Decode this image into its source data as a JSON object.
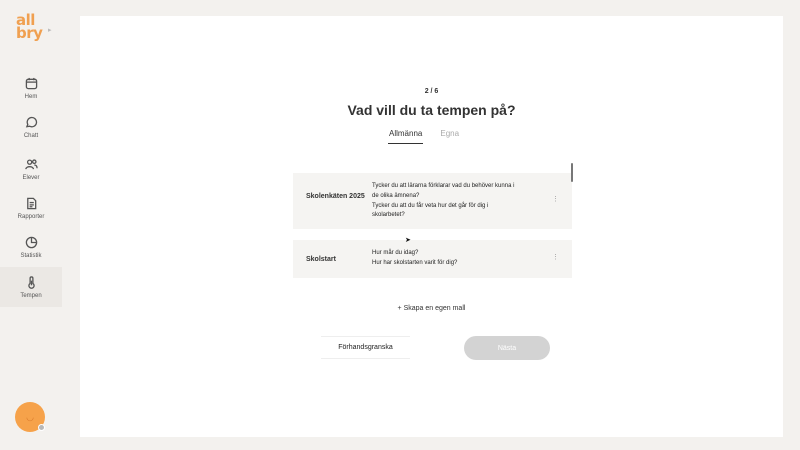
{
  "logo": {
    "line1": "all",
    "line2": "bry"
  },
  "sidebar": {
    "items": [
      {
        "label": "Hem",
        "icon": "calendar-icon"
      },
      {
        "label": "Chatt",
        "icon": "chat-icon"
      },
      {
        "label": "Elever",
        "icon": "users-icon"
      },
      {
        "label": "Rapporter",
        "icon": "report-icon"
      },
      {
        "label": "Statistik",
        "icon": "pie-chart-icon"
      },
      {
        "label": "Tempen",
        "icon": "thermometer-icon"
      }
    ],
    "active": "Tempen"
  },
  "main": {
    "step": "2 / 6",
    "title": "Vad vill du ta tempen på?",
    "tabs": [
      {
        "label": "Allmänna",
        "active": true
      },
      {
        "label": "Egna",
        "active": false
      }
    ],
    "templates": [
      {
        "name": "Skolenkäten 2025",
        "questions": [
          "Tycker du att lärarna förklarar vad du behöver kunna i de olika ämnena?",
          "Tycker du att du får veta hur det går för dig i skolarbetet?"
        ],
        "menu": "⋮"
      },
      {
        "name": "Skolstart",
        "questions": [
          "Hur mår du idag?",
          "Hur har skolstarten varit för dig?"
        ],
        "menu": "⋮"
      }
    ],
    "create_link": "+ Skapa en egen mall",
    "preview_button": "Förhandsgranska",
    "next_button": "Nästa"
  },
  "colors": {
    "accent": "#f6a24a",
    "background": "#f3f1ee",
    "card": "#ffffff",
    "template_bg": "#f5f4f2",
    "disabled_button": "#d3d3d3"
  }
}
